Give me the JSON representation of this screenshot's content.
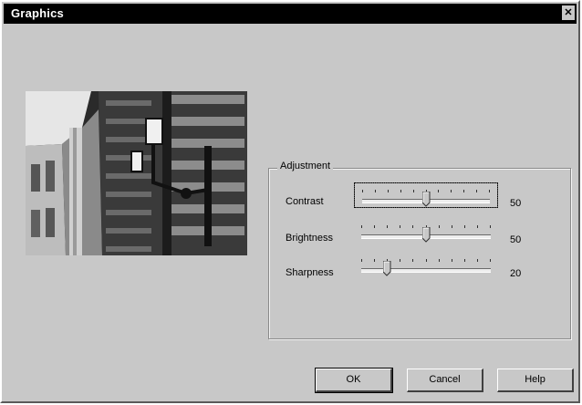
{
  "window": {
    "title": "Graphics",
    "close_glyph": "✕"
  },
  "preview": {
    "icon": "photo-preview"
  },
  "adjustment": {
    "group_label": "Adjustment",
    "sliders": [
      {
        "label": "Contrast",
        "value": "50",
        "level": 50,
        "max": 100
      },
      {
        "label": "Brightness",
        "value": "50",
        "level": 50,
        "max": 100
      },
      {
        "label": "Sharpness",
        "value": "20",
        "level": 20,
        "max": 100
      }
    ]
  },
  "buttons": {
    "ok": "OK",
    "cancel": "Cancel",
    "help": "Help"
  }
}
